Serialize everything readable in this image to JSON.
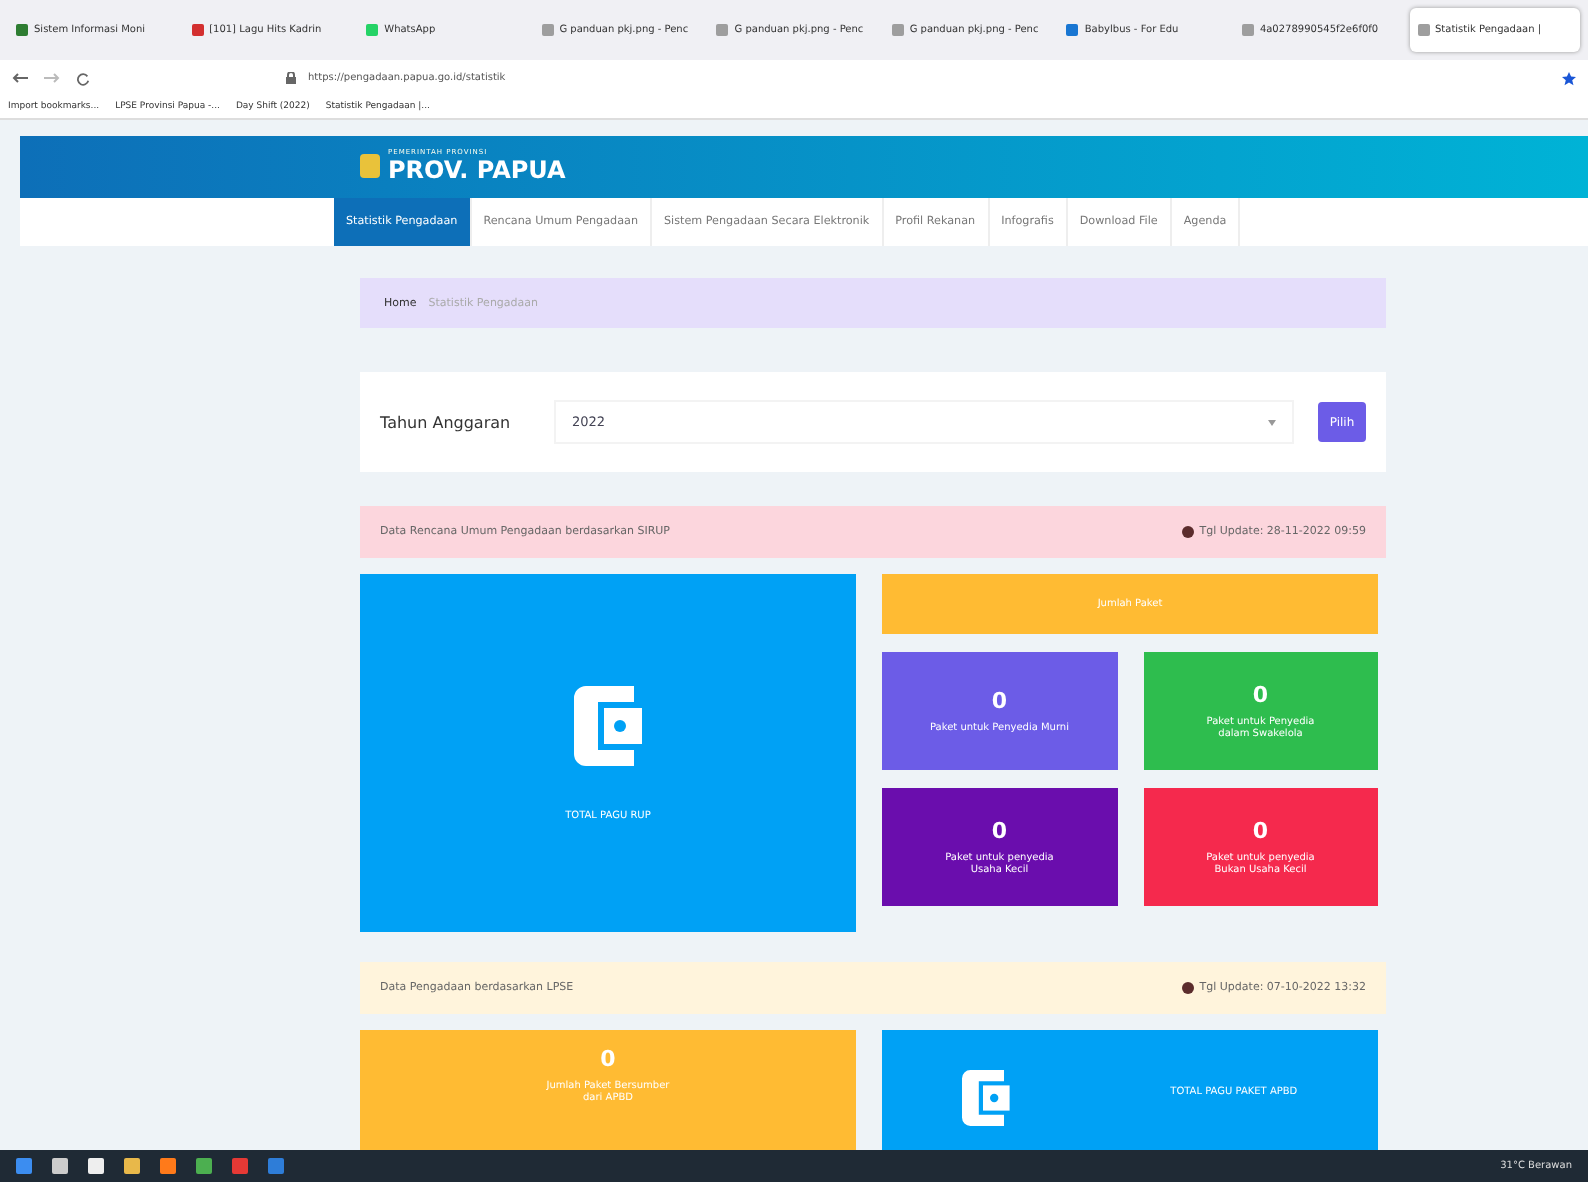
{
  "browser": {
    "tabs": [
      {
        "label": "Sistem Informasi Moni",
        "selected": false,
        "color": "#2e7d32"
      },
      {
        "label": "[101] Lagu Hits Kadrin",
        "selected": false,
        "color": "#d32f2f"
      },
      {
        "label": "WhatsApp",
        "selected": false,
        "color": "#25d366"
      },
      {
        "label": "G panduan pkj.png - Penc",
        "selected": false,
        "color": "#9e9e9e"
      },
      {
        "label": "G panduan pkj.png - Penc",
        "selected": false,
        "color": "#9e9e9e"
      },
      {
        "label": "G panduan pkj.png - Penc",
        "selected": false,
        "color": "#9e9e9e"
      },
      {
        "label": "Babylbus - For Edu",
        "selected": false,
        "color": "#1976d2"
      },
      {
        "label": "4a0278990545f2e6f0f0",
        "selected": false,
        "color": "#9e9e9e"
      },
      {
        "label": "Statistik Pengadaan |",
        "selected": true,
        "color": "#9e9e9e"
      }
    ],
    "url": "https://pengadaan.papua.go.id/statistik",
    "bookmarks": [
      {
        "label": "Import bookmarks..."
      },
      {
        "label": "LPSE Provinsi Papua -..."
      },
      {
        "label": "Day Shift (2022)"
      },
      {
        "label": "Statistik Pengadaan |..."
      }
    ]
  },
  "site": {
    "subtitle": "PEMERINTAH PROVINSI",
    "title": "PROV. PAPUA"
  },
  "nav": [
    {
      "label": "Statistik Pengadaan",
      "selected": true
    },
    {
      "label": "Rencana Umum Pengadaan",
      "selected": false
    },
    {
      "label": "Sistem Pengadaan Secara Elektronik",
      "selected": false
    },
    {
      "label": "Profil Rekanan",
      "selected": false
    },
    {
      "label": "Infografis",
      "selected": false
    },
    {
      "label": "Download File",
      "selected": false
    },
    {
      "label": "Agenda",
      "selected": false
    }
  ],
  "breadcrumb": [
    "Home",
    "Statistik Pengadaan"
  ],
  "filter": {
    "label": "Tahun Anggaran",
    "value": "2022",
    "button": "Pilih"
  },
  "sections": [
    {
      "title": "Data Rencana Umum Pengadaan berdasarkan SIRUP",
      "update": "Tgl Update: 28-11-2022 09:59",
      "color": "#fcd6dd"
    },
    {
      "title": "Data Pengadaan berdasarkan LPSE",
      "update": "Tgl Update: 07-10-2022 13:32",
      "color": "#fff4dc"
    }
  ],
  "rup": {
    "total_label": "TOTAL PAGU RUP",
    "count_header": "Jumlah Paket",
    "tiles": [
      {
        "value": "0",
        "label": "Paket untuk Penyedia Murni",
        "color": "#6c5ce7"
      },
      {
        "value": "0",
        "label": "Paket untuk Penyedia dalam Swakelola",
        "color": "#2ebd4e"
      },
      {
        "value": "0",
        "label": "Paket untuk penyedia Usaha Kecil",
        "color": "#6a0dad"
      },
      {
        "value": "0",
        "label": "Paket untuk penyedia Bukan Usaha Kecil",
        "color": "#f5294d"
      }
    ]
  },
  "lpse": {
    "count": "0",
    "count_label": "Jumlah Paket Bersumber dari APBD",
    "total_label": "TOTAL PAGU PAKET APBD"
  },
  "taskbar": {
    "weather": "31°C Berawan"
  }
}
